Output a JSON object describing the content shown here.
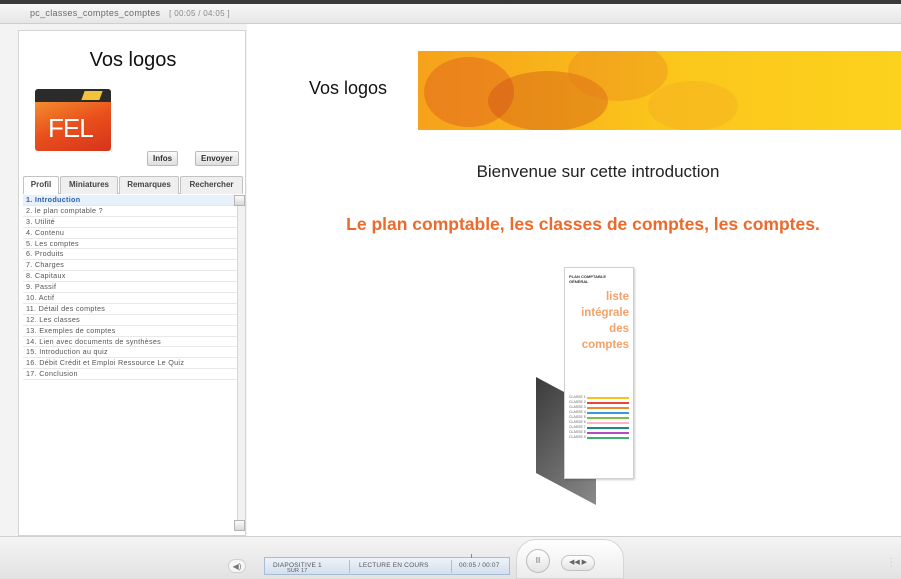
{
  "window": {
    "title": "pc_classes_comptes_comptes",
    "time": "[ 00:05 / 04:05 ]"
  },
  "sidebar": {
    "logo_text": "Vos logos",
    "logo_brand": "FEL",
    "buttons": {
      "info": "Infos",
      "send": "Envoyer"
    },
    "tabs": [
      "Profil",
      "Miniatures",
      "Remarques",
      "Rechercher"
    ],
    "active_tab": "Profil",
    "toc": [
      "1. Introduction",
      "2. le plan comptable ?",
      "3. Utilité",
      "4. Contenu",
      "5. Les comptes",
      "6. Produits",
      "7. Charges",
      "8. Capitaux",
      "9. Passif",
      "10. Actif",
      "11. Détail des comptes",
      "12. Les classes",
      "13. Exemples de comptes",
      "14. Lien avec documents de synthèses",
      "15. Introduction au quiz",
      "16. Débit Crédit et Emploi Ressource Le Quiz",
      "17. Conclusion"
    ],
    "active_index": 0
  },
  "slide": {
    "logo_text": "Vos logos",
    "welcome": "Bienvenue sur cette introduction",
    "headline": "Le plan comptable, les classes de comptes, les comptes.",
    "document": {
      "header": [
        "PLAN COMPTABLE",
        "GÉNÉRAL"
      ],
      "title_lines": [
        "liste",
        "intégrale",
        "des",
        "comptes"
      ],
      "classes": [
        "CLASSE 1",
        "CLASSE 2",
        "CLASSE 3",
        "CLASSE 4",
        "CLASSE 5",
        "CLASSE 6",
        "CLASSE 7",
        "CLASSE 8",
        "CLASSE 9"
      ],
      "class_colors": [
        "#f2c41e",
        "#e8463a",
        "#f08a2a",
        "#3a9ad9",
        "#7bc043",
        "#f7b7c9",
        "#1b8a8a",
        "#b04fc5",
        "#3ab36e"
      ]
    }
  },
  "controls": {
    "volume_label": "◀)",
    "slide_label": "DIAPOSITIVE 1",
    "slide_of": "SUR 17",
    "state_label": "LECTURE EN COURS",
    "time_label": "00:05 / 00:07",
    "pause_label": "II",
    "nav_label": "◀◀ ▶",
    "colors": {
      "status_bg": "#d3e0ee",
      "accent_orange": "#ec6a2b"
    }
  }
}
